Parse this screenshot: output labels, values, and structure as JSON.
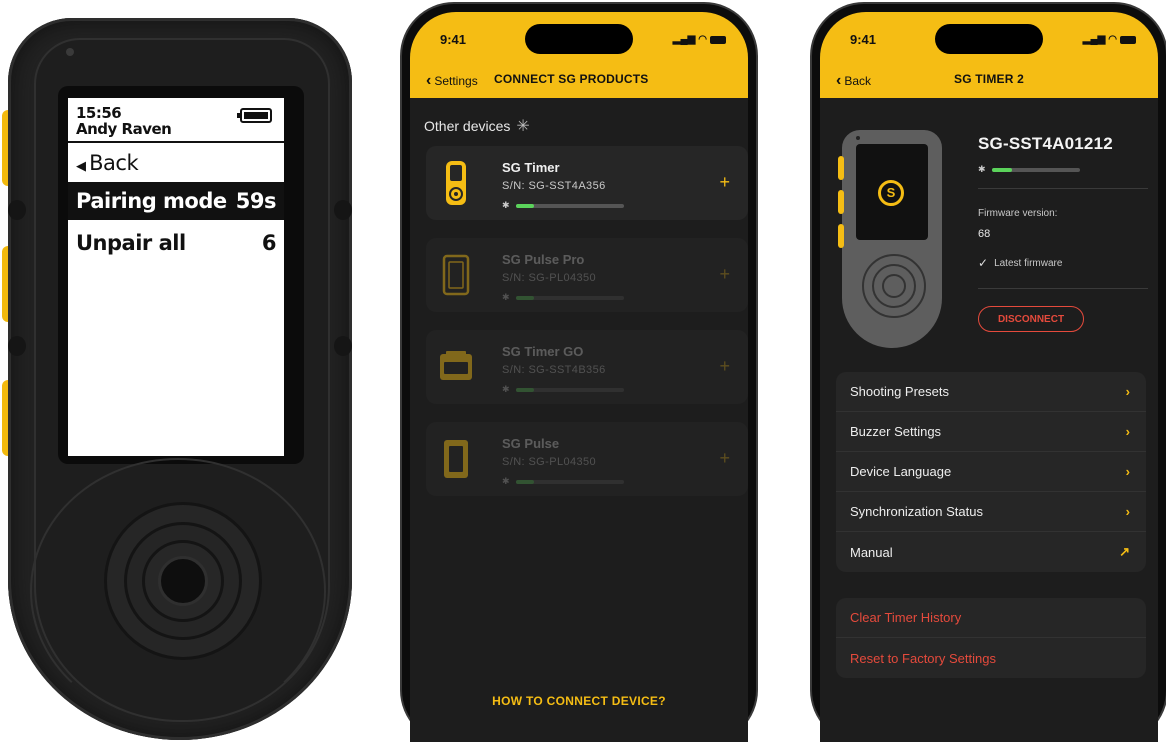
{
  "device": {
    "time": "15:56",
    "user": "Andy Raven",
    "back_label": "Back",
    "menu": [
      {
        "label": "Pairing mode",
        "value": "59s"
      },
      {
        "label": "Unpair all",
        "value": "6"
      }
    ]
  },
  "phone1": {
    "status_time": "9:41",
    "back_label": "Settings",
    "title": "CONNECT SG PRODUCTS",
    "section_label": "Other devices",
    "devices": [
      {
        "name": "SG Timer",
        "serial": "S/N:  SG-SST4A356",
        "signal": 0.15,
        "icon": "sg-timer-icon"
      },
      {
        "name": "SG Pulse Pro",
        "serial": "S/N:  SG-PL04350",
        "signal": 0.15,
        "icon": "sg-pulse-pro-icon"
      },
      {
        "name": "SG Timer GO",
        "serial": "S/N:  SG-SST4B356",
        "signal": 0.15,
        "icon": "sg-timer-go-icon"
      },
      {
        "name": "SG Pulse",
        "serial": "S/N:  SG-PL04350",
        "signal": 0.15,
        "icon": "sg-pulse-icon"
      }
    ],
    "add_symbol": "+",
    "bluetooth_symbol": "✱",
    "howto_label": "HOW TO CONNECT DEVICE?"
  },
  "phone2": {
    "status_time": "9:41",
    "back_label": "Back",
    "title": "SG TIMER 2",
    "serial": "SG-SST4A01212",
    "signal": 0.2,
    "firmware_label": "Firmware version:",
    "firmware_value": "68",
    "firmware_status": "Latest firmware",
    "disconnect_label": "DISCONNECT",
    "menu": [
      {
        "label": "Shooting Presets",
        "icon": "chevron-right-icon",
        "glyph": "›"
      },
      {
        "label": "Buzzer Settings",
        "icon": "chevron-right-icon",
        "glyph": "›"
      },
      {
        "label": "Device Language",
        "icon": "chevron-right-icon",
        "glyph": "›"
      },
      {
        "label": "Synchronization Status",
        "icon": "chevron-right-icon",
        "glyph": "›"
      },
      {
        "label": "Manual",
        "icon": "external-link-icon",
        "glyph": "↗"
      }
    ],
    "danger": [
      {
        "label": "Clear Timer History"
      },
      {
        "label": "Reset to Factory Settings"
      }
    ]
  },
  "colors": {
    "accent": "#f5bd14",
    "danger": "#e54a3c",
    "signal": "#5bd35b",
    "phone_bg": "#1d1d1d"
  }
}
